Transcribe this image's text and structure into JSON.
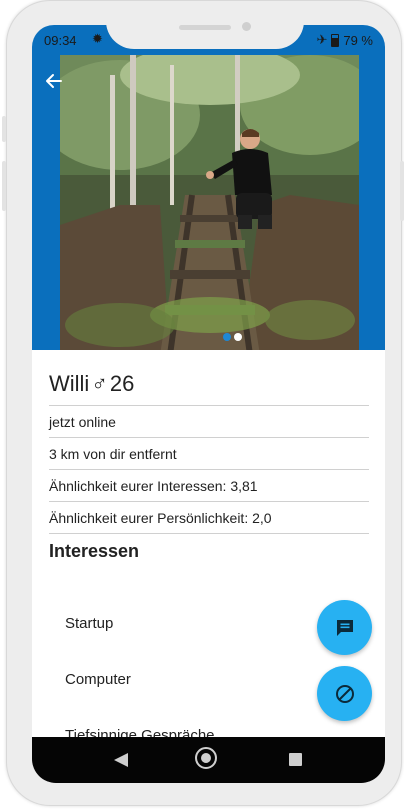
{
  "status_bar": {
    "time": "09:34",
    "battery": "79 %"
  },
  "profile": {
    "name": "Willi",
    "gender_symbol": "♂",
    "age": "26",
    "online": "jetzt online",
    "distance": "3 km von dir entfernt",
    "interest_similarity": "Ähnlichkeit eurer Interessen: 3,81",
    "personality_similarity": "Ähnlichkeit eurer Persönlichkeit: 2,0"
  },
  "interests": {
    "title": "Interessen",
    "items": [
      "Startup",
      "Computer",
      "Tiefsinnige Gespräche"
    ]
  },
  "photo_carousel": {
    "count": 2,
    "active_index": 0
  },
  "icons": {
    "back": "arrow-left-icon",
    "chat_fab": "chat-icon",
    "block_fab": "block-icon",
    "nav_back": "triangle-back-icon",
    "nav_home": "circle-home-icon",
    "nav_recent": "square-recent-icon"
  },
  "colors": {
    "header_blue": "#0a6fbd",
    "fab_blue": "#27b1f2",
    "text": "#222222"
  }
}
